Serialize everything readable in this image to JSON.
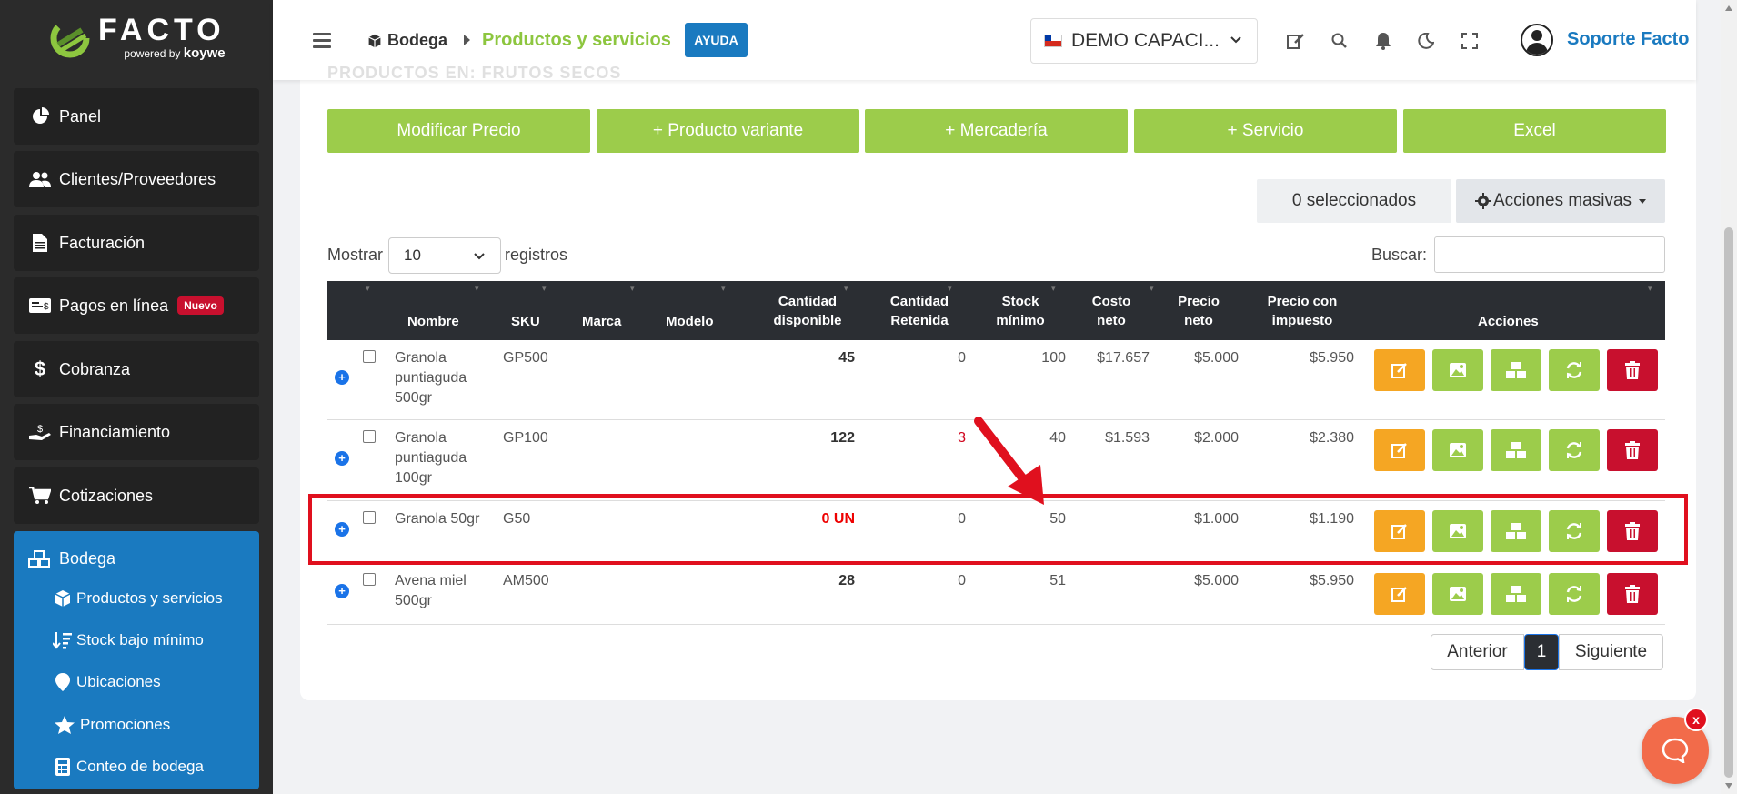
{
  "brand": {
    "name": "FACTO",
    "powered": "powered by",
    "partner": "koywe"
  },
  "sidebar": {
    "items": [
      {
        "label": "Panel",
        "icon": "pie-chart-icon"
      },
      {
        "label": "Clientes/Proveedores",
        "icon": "users-icon"
      },
      {
        "label": "Facturación",
        "icon": "document-icon"
      },
      {
        "label": "Pagos en línea",
        "icon": "money-icon",
        "badge": "Nuevo"
      },
      {
        "label": "Cobranza",
        "icon": "dollar-icon"
      },
      {
        "label": "Financiamiento",
        "icon": "hand-money-icon"
      },
      {
        "label": "Cotizaciones",
        "icon": "cart-icon"
      }
    ],
    "active": {
      "label": "Bodega",
      "icon": "boxes-icon",
      "sub_items": [
        {
          "label": "Productos y servicios",
          "icon": "cube-icon"
        },
        {
          "label": "Stock bajo mínimo",
          "icon": "sort-down-icon"
        },
        {
          "label": "Ubicaciones",
          "icon": "map-pin-icon"
        },
        {
          "label": "Promociones",
          "icon": "star-icon"
        },
        {
          "label": "Conteo de bodega",
          "icon": "calculator-icon"
        }
      ]
    }
  },
  "header": {
    "breadcrumb_root": "Bodega",
    "breadcrumb_current": "Productos y servicios",
    "help": "AYUDA",
    "company": "DEMO CAPACI...",
    "user": "Soporte Facto"
  },
  "main": {
    "faded_title": "PRODUCTOS EN: FRUTOS SECOS",
    "buttons": [
      "Modificar Precio",
      "+ Producto variante",
      "+ Mercadería",
      "+ Servicio",
      "Excel"
    ],
    "selected_count": "0 seleccionados",
    "bulk_actions": "Acciones masivas",
    "show_label": "Mostrar",
    "show_value": "10",
    "records_label": "registros",
    "search_label": "Buscar:",
    "columns": {
      "nombre": "Nombre",
      "sku": "SKU",
      "marca": "Marca",
      "modelo": "Modelo",
      "cant_disp_1": "Cantidad",
      "cant_disp_2": "disponible",
      "cant_ret_1": "Cantidad",
      "cant_ret_2": "Retenida",
      "stock_1": "Stock",
      "stock_2": "mínimo",
      "costo_1": "Costo",
      "costo_2": "neto",
      "precio_1": "Precio",
      "precio_2": "neto",
      "pimp_1": "Precio con",
      "pimp_2": "impuesto",
      "acciones": "Acciones"
    },
    "rows": [
      {
        "name": [
          "Granola",
          "puntiaguda",
          "500gr"
        ],
        "sku": "GP500",
        "disp": "45",
        "ret": "0",
        "stock": "100",
        "costo": "$17.657",
        "precio": "$5.000",
        "pimp": "$5.950"
      },
      {
        "name": [
          "Granola",
          "puntiaguda",
          "100gr"
        ],
        "sku": "GP100",
        "disp": "122",
        "ret": "3",
        "stock": "40",
        "costo": "$1.593",
        "precio": "$2.000",
        "pimp": "$2.380"
      },
      {
        "name": [
          "Granola 50gr"
        ],
        "sku": "G50",
        "disp": "0 UN",
        "ret": "0",
        "stock": "50",
        "costo": "",
        "precio": "$1.000",
        "pimp": "$1.190"
      },
      {
        "name": [
          "Avena miel",
          "500gr"
        ],
        "sku": "AM500",
        "disp": "28",
        "ret": "0",
        "stock": "51",
        "costo": "",
        "precio": "$5.000",
        "pimp": "$5.950"
      }
    ],
    "pagination": {
      "prev": "Anterior",
      "current": "1",
      "next": "Siguiente"
    }
  },
  "chat": {
    "close": "x"
  },
  "colors": {
    "sidebar_bg": "#2b2b2b",
    "active_blue": "#1a7ac0",
    "green": "#9ccc4b",
    "orange": "#f5a623",
    "danger": "#c8102e",
    "highlight": "#e0101e"
  }
}
